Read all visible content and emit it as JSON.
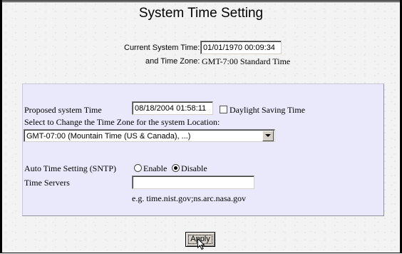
{
  "page": {
    "title": "System Time Setting",
    "current_time_label": "Current System Time:",
    "current_time_value": "01/01/1970 00:09:34",
    "timezone_label": "and Time Zone:",
    "timezone_value": "GMT-7:00 Standard Time"
  },
  "settings": {
    "proposed_label": "Proposed system Time",
    "proposed_value": "08/18/2004 01:58:11",
    "dst_label": "Daylight Saving Time",
    "dst_checked": false,
    "zone_select_label": "Select to Change the Time Zone for the system Location:",
    "zone_select_value": "GMT-07:00 (Mountain Time (US & Canada), ...)",
    "sntp_label": "Auto Time Setting (SNTP)",
    "sntp_enable_label": "Enable",
    "sntp_disable_label": "Disable",
    "sntp_selected": "Disable",
    "servers_label": "Time Servers",
    "servers_value": "",
    "servers_hint": "e.g. time.nist.gov;ns.arc.nasa.gov"
  },
  "actions": {
    "apply_label": "Apply"
  },
  "icons": {
    "dropdown": "chevron-down-icon",
    "cursor": "mouse-pointer-icon"
  }
}
